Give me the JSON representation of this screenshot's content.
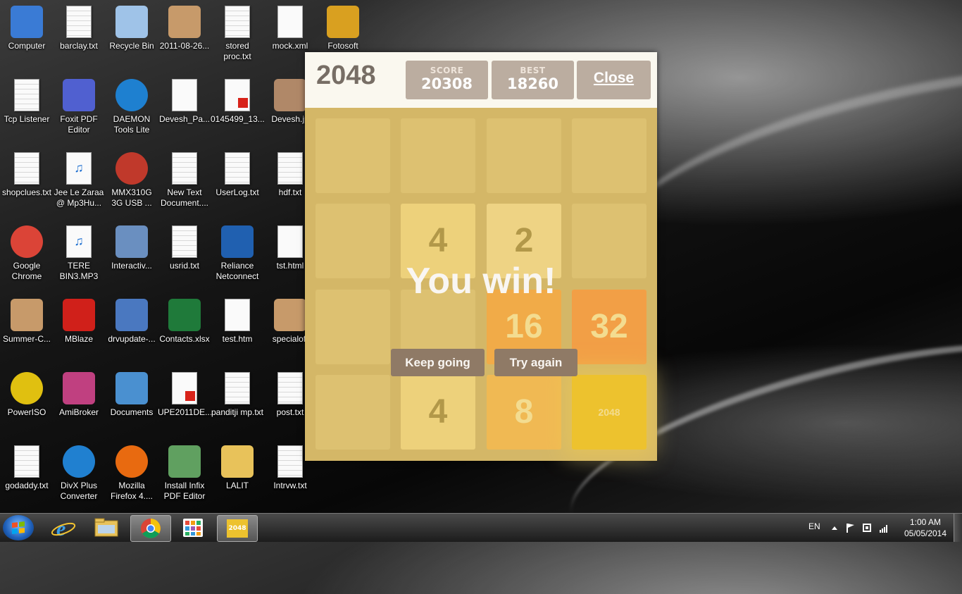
{
  "desktop": {
    "icons": [
      {
        "label": "Computer",
        "icon": "computer-icon"
      },
      {
        "label": "barclay.txt",
        "icon": "text-file-icon"
      },
      {
        "label": "Recycle Bin",
        "icon": "recycle-bin-icon"
      },
      {
        "label": "2011-08-26...",
        "icon": "image-file-icon"
      },
      {
        "label": "stored proc.txt",
        "icon": "text-file-icon"
      },
      {
        "label": "mock.xml",
        "icon": "xml-file-icon"
      },
      {
        "label": "Fotosoft",
        "icon": "fotosoft-icon"
      },
      {
        "label": "Tcp Listener",
        "icon": "text-file-icon"
      },
      {
        "label": "Foxit PDF Editor",
        "icon": "foxit-icon"
      },
      {
        "label": "DAEMON Tools Lite",
        "icon": "daemon-tools-icon"
      },
      {
        "label": "Devesh_Pa...",
        "icon": "document-icon"
      },
      {
        "label": "0145499_13...",
        "icon": "pdf-file-icon"
      },
      {
        "label": "Devesh.jp",
        "icon": "photo-icon"
      },
      {
        "label": "shopclues.txt",
        "icon": "text-file-icon"
      },
      {
        "label": "Jee Le Zaraa @ Mp3Hu...",
        "icon": "mp3-file-icon"
      },
      {
        "label": "MMX310G 3G USB ...",
        "icon": "mmx-icon"
      },
      {
        "label": "New Text Document....",
        "icon": "text-file-icon"
      },
      {
        "label": "UserLog.txt",
        "icon": "text-file-icon"
      },
      {
        "label": "hdf.txt",
        "icon": "text-file-icon"
      },
      {
        "label": "Google Chrome",
        "icon": "chrome-icon"
      },
      {
        "label": "TERE BIN3.MP3",
        "icon": "mp3-file-icon"
      },
      {
        "label": "Interactiv...",
        "icon": "interactive-icon"
      },
      {
        "label": "usrid.txt",
        "icon": "text-file-icon"
      },
      {
        "label": "Reliance Netconnect",
        "icon": "reliance-icon"
      },
      {
        "label": "tst.html",
        "icon": "html-file-icon"
      },
      {
        "label": "Summer-C...",
        "icon": "image-file-icon"
      },
      {
        "label": "MBlaze",
        "icon": "mblaze-icon"
      },
      {
        "label": "drvupdate-...",
        "icon": "driver-update-icon"
      },
      {
        "label": "Contacts.xlsx",
        "icon": "excel-file-icon"
      },
      {
        "label": "test.htm",
        "icon": "html-file-icon"
      },
      {
        "label": "specialoff",
        "icon": "image-file-icon"
      },
      {
        "label": "PowerISO",
        "icon": "poweriso-icon"
      },
      {
        "label": "AmiBroker",
        "icon": "amibroker-icon"
      },
      {
        "label": "Documents",
        "icon": "documents-icon"
      },
      {
        "label": "UPE2011DE...",
        "icon": "pdf-file-icon"
      },
      {
        "label": "panditji mp.txt",
        "icon": "text-file-icon"
      },
      {
        "label": "post.txt",
        "icon": "text-file-icon"
      },
      {
        "label": "godaddy.txt",
        "icon": "text-file-icon"
      },
      {
        "label": "DivX Plus Converter",
        "icon": "divx-icon"
      },
      {
        "label": "Mozilla Firefox 4....",
        "icon": "firefox-icon"
      },
      {
        "label": "Install Infix PDF Editor",
        "icon": "installer-icon"
      },
      {
        "label": "LALIT",
        "icon": "folder-icon"
      },
      {
        "label": "Intrvw.txt",
        "icon": "text-file-icon"
      }
    ]
  },
  "game": {
    "title": "2048",
    "score_label": "SCORE",
    "score": "20308",
    "best_label": "BEST",
    "best": "18260",
    "close_label": "Close",
    "tiles": [
      {
        "value": "4",
        "row": 1,
        "col": 1
      },
      {
        "value": "2",
        "row": 1,
        "col": 2
      },
      {
        "value": "16",
        "row": 2,
        "col": 2
      },
      {
        "value": "32",
        "row": 2,
        "col": 3
      },
      {
        "value": "4",
        "row": 3,
        "col": 1
      },
      {
        "value": "8",
        "row": 3,
        "col": 2
      },
      {
        "value": "2048",
        "row": 3,
        "col": 3
      }
    ],
    "message": "You win!",
    "keep_going_label": "Keep going",
    "try_again_label": "Try again"
  },
  "taskbar": {
    "language": "EN",
    "time": "1:00 AM",
    "date": "05/05/2014",
    "pinned": [
      "start-button",
      "internet-explorer-icon",
      "file-explorer-icon",
      "chrome-icon",
      "apps-grid-icon",
      "2048-app-icon"
    ],
    "active_app_label": "2048"
  },
  "colors": {
    "tile_2": "#eee4da",
    "tile_4": "#ede0c8",
    "tile_8": "#f2b179",
    "tile_16": "#f59563",
    "tile_32": "#f67c5f",
    "tile_2048": "#edc22e",
    "board": "#bbada0",
    "button": "#8f7a66"
  }
}
